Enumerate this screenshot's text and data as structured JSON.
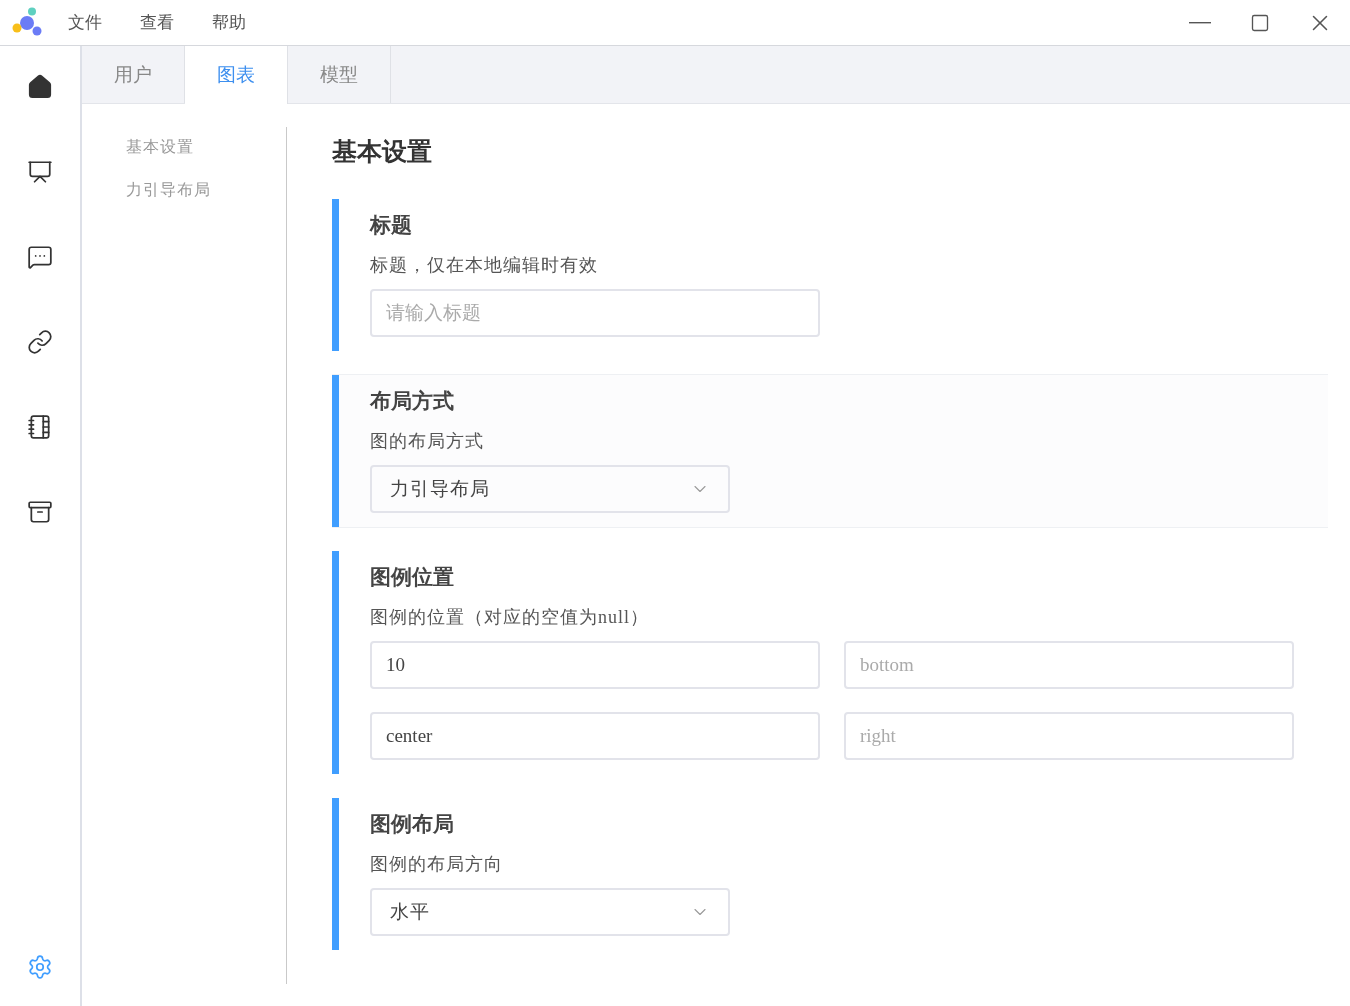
{
  "menu": [
    {
      "label": "文件"
    },
    {
      "label": "查看"
    },
    {
      "label": "帮助"
    }
  ],
  "tabs": [
    {
      "label": "用户",
      "selected": false
    },
    {
      "label": "图表",
      "selected": true
    },
    {
      "label": "模型",
      "selected": false
    }
  ],
  "nav": [
    {
      "label": "基本设置"
    },
    {
      "label": "力引导布局"
    }
  ],
  "heading": "基本设置",
  "sections": [
    {
      "title": "标题",
      "description": "标题，仅在本地编辑时有效",
      "highlighted": false,
      "fields": [
        {
          "kind": "input",
          "placeholder": "请输入标题"
        }
      ]
    },
    {
      "title": "布局方式",
      "description": "图的布局方式",
      "highlighted": true,
      "fields": [
        {
          "kind": "select",
          "value": "力引导布局"
        }
      ]
    },
    {
      "title": "图例位置",
      "description": "图例的位置（对应的空值为null）",
      "highlighted": false,
      "fields": [
        {
          "kind": "input",
          "value": "10"
        },
        {
          "kind": "input",
          "placeholder": "bottom"
        },
        {
          "kind": "input",
          "value": "center"
        },
        {
          "kind": "input",
          "placeholder": "right"
        }
      ]
    },
    {
      "title": "图例布局",
      "description": "图例的布局方向",
      "highlighted": false,
      "fields": [
        {
          "kind": "select",
          "value": "水平"
        }
      ]
    }
  ]
}
